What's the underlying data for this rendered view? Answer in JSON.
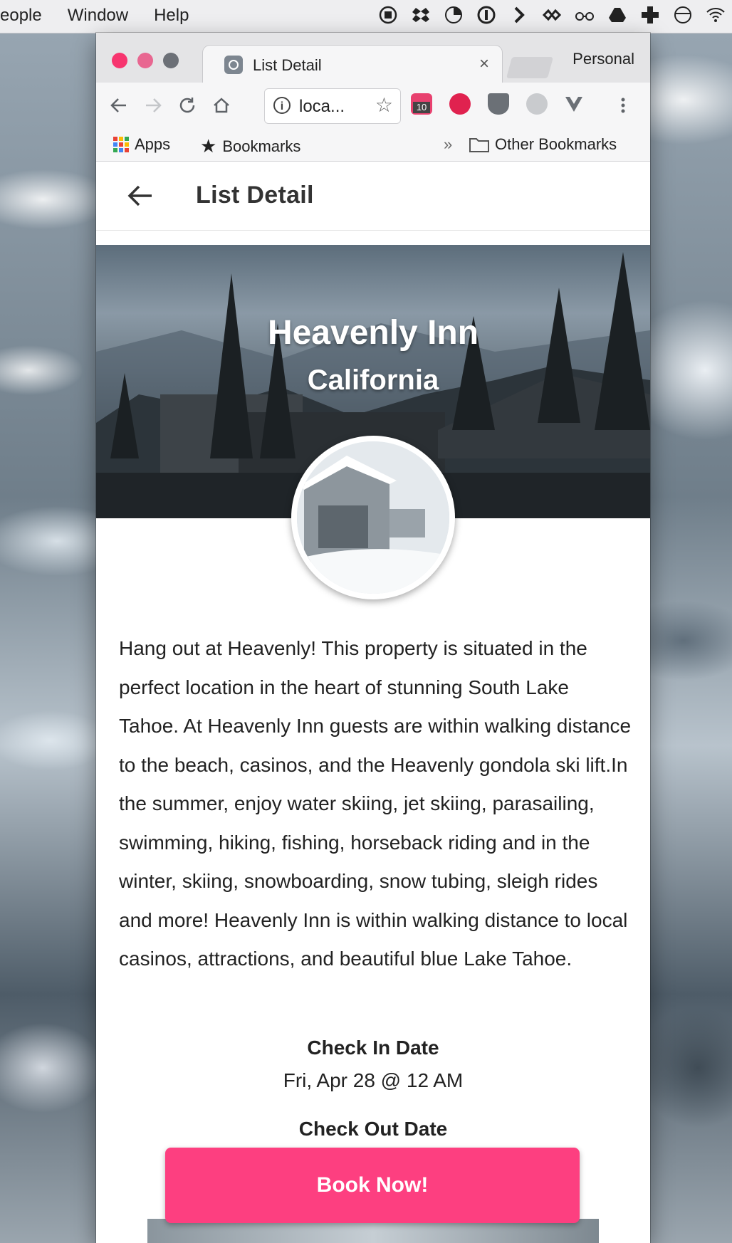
{
  "menubar": {
    "items": [
      "eople",
      "Window",
      "Help"
    ],
    "tray_icons": [
      "stop-icon",
      "dropbox-icon",
      "pie-icon",
      "onepassword-icon",
      "chevron-icon",
      "infinity-icon",
      "glasses-icon",
      "drive-icon",
      "plus-icon",
      "circle-slash-icon",
      "wifi-icon"
    ]
  },
  "browser": {
    "tab_title": "List Detail",
    "tab_close": "×",
    "profile": "Personal",
    "url": "loca...",
    "extension_badge": "10",
    "bookmarks": {
      "apps": "Apps",
      "bookmarks": "Bookmarks",
      "overflow": "»",
      "other": "Other Bookmarks"
    }
  },
  "page": {
    "appbar_title": "List Detail",
    "hotel_name": "Heavenly Inn",
    "location": "California",
    "description": "Hang out at Heavenly! This property is situated in the perfect location in the heart of stunning South Lake Tahoe. At Heavenly Inn guests are within walking distance to the beach, casinos, and the Heavenly gondola ski lift.In the summer, enjoy water skiing, jet skiing, parasailing, swimming, hiking, fishing, horseback riding and in the winter, skiing, snowboarding, snow tubing, sleigh rides and more! Heavenly Inn is within walking distance to local casinos, attractions, and beautiful blue Lake Tahoe.",
    "check_in_label": "Check In Date",
    "check_in_value": "Fri, Apr 28 @ 12 AM",
    "check_out_label": "Check Out Date",
    "book_button": "Book Now!"
  },
  "colors": {
    "accent": "#fd3f80",
    "traffic_red": "#f7356f"
  }
}
